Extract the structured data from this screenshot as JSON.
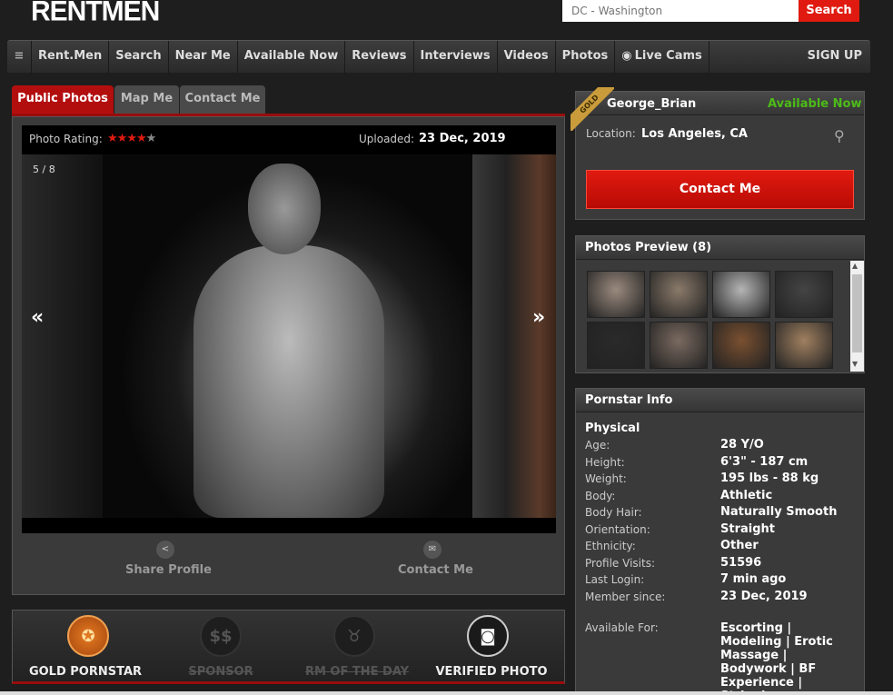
{
  "logo": {
    "text_a": "RENT",
    "text_b": "MEN"
  },
  "search": {
    "placeholder": "DC - Washington",
    "button_label": "Search"
  },
  "nav": {
    "menu_icon": "≡",
    "items": [
      "Rent.Men",
      "Search",
      "Near Me",
      "Available Now",
      "Reviews",
      "Interviews",
      "Videos",
      "Photos",
      "Live Cams"
    ],
    "signup": "SIGN UP"
  },
  "tabs": [
    "Public Photos",
    "Map Me",
    "Contact Me"
  ],
  "photo": {
    "rating_label": "Photo Rating:",
    "rating": 4,
    "rating_max": 5,
    "uploaded_label": "Uploaded:",
    "uploaded_date": "23 Dec, 2019",
    "counter": "5 / 8",
    "prev": "«",
    "next": "»"
  },
  "actions": {
    "share": "Share Profile",
    "contact": "Contact Me"
  },
  "badges": [
    {
      "label": "GOLD PORNSTAR",
      "active": true,
      "icon": "medal-icon"
    },
    {
      "label": "SPONSOR",
      "active": false,
      "icon": "dollar-icon"
    },
    {
      "label": "RM OF THE DAY",
      "active": false,
      "icon": "horns-icon"
    },
    {
      "label": "VERIFIED PHOTO",
      "active": true,
      "icon": "camera-icon"
    }
  ],
  "profile": {
    "ribbon": "GOLD",
    "username": "George_Brian",
    "status": "Available Now",
    "status_color": "#4cbb17",
    "location_label": "Location:",
    "location": "Los Angeles, CA",
    "contact_button": "Contact Me"
  },
  "preview": {
    "title": "Photos Preview (8)",
    "thumbs": [
      "#9a8a7e",
      "#8a7a6a",
      "#b5b5b5",
      "#444",
      "#2a2a2a",
      "#7a6a60",
      "#7a5030",
      "#a08060"
    ]
  },
  "info": {
    "title": "Pornstar Info",
    "section": "Physical",
    "rows": [
      {
        "label": "Age:",
        "value": "28 Y/O"
      },
      {
        "label": "Height:",
        "value": "6'3\" - 187 cm"
      },
      {
        "label": "Weight:",
        "value": "195 lbs - 88 kg"
      },
      {
        "label": "Body:",
        "value": "Athletic"
      },
      {
        "label": "Body Hair:",
        "value": "Naturally Smooth"
      },
      {
        "label": "Orientation:",
        "value": "Straight"
      },
      {
        "label": "Ethnicity:",
        "value": "Other"
      },
      {
        "label": "Profile Visits:",
        "value": "51596"
      },
      {
        "label": "Last Login:",
        "value": "7 min ago"
      },
      {
        "label": "Member since:",
        "value": "23 Dec, 2019"
      }
    ],
    "available_label": "Available For:",
    "available_value": "Escorting | Modeling | Erotic Massage | Bodywork | BF Experience | Stripping"
  },
  "colors": {
    "accent": "#e01a10",
    "available": "#4cbb17",
    "gold": "#c99b3a"
  }
}
